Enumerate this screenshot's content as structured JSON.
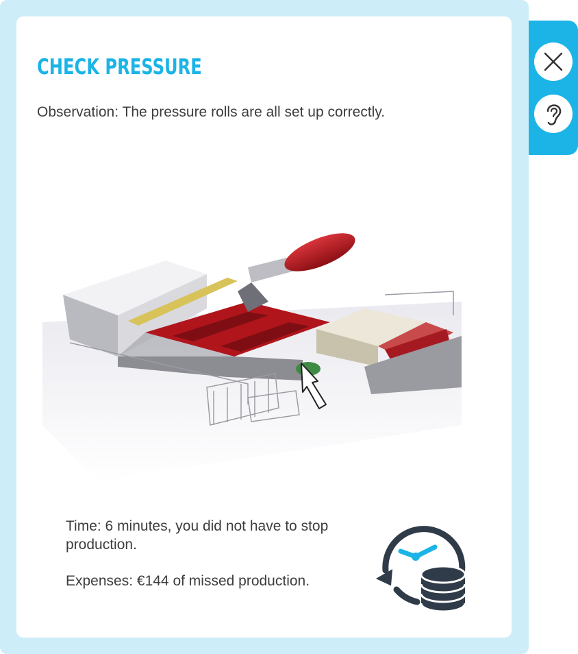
{
  "dialog": {
    "title": "CHECK PRESSURE",
    "observation": "Observation: The pressure rolls are all set up correctly.",
    "time_text": "Time: 6 minutes, you did not have to stop production.",
    "expenses_text": "Expenses: €144 of missed production."
  },
  "icons": {
    "close": "close-icon",
    "audio": "ear-icon",
    "time_cost": "clock-coins-icon",
    "pointer": "arrow-pointer-icon"
  },
  "colors": {
    "accent": "#1cb4e6",
    "frame": "#cdeef8",
    "text": "#3d3d3d",
    "icon_dark": "#2f3b48"
  }
}
